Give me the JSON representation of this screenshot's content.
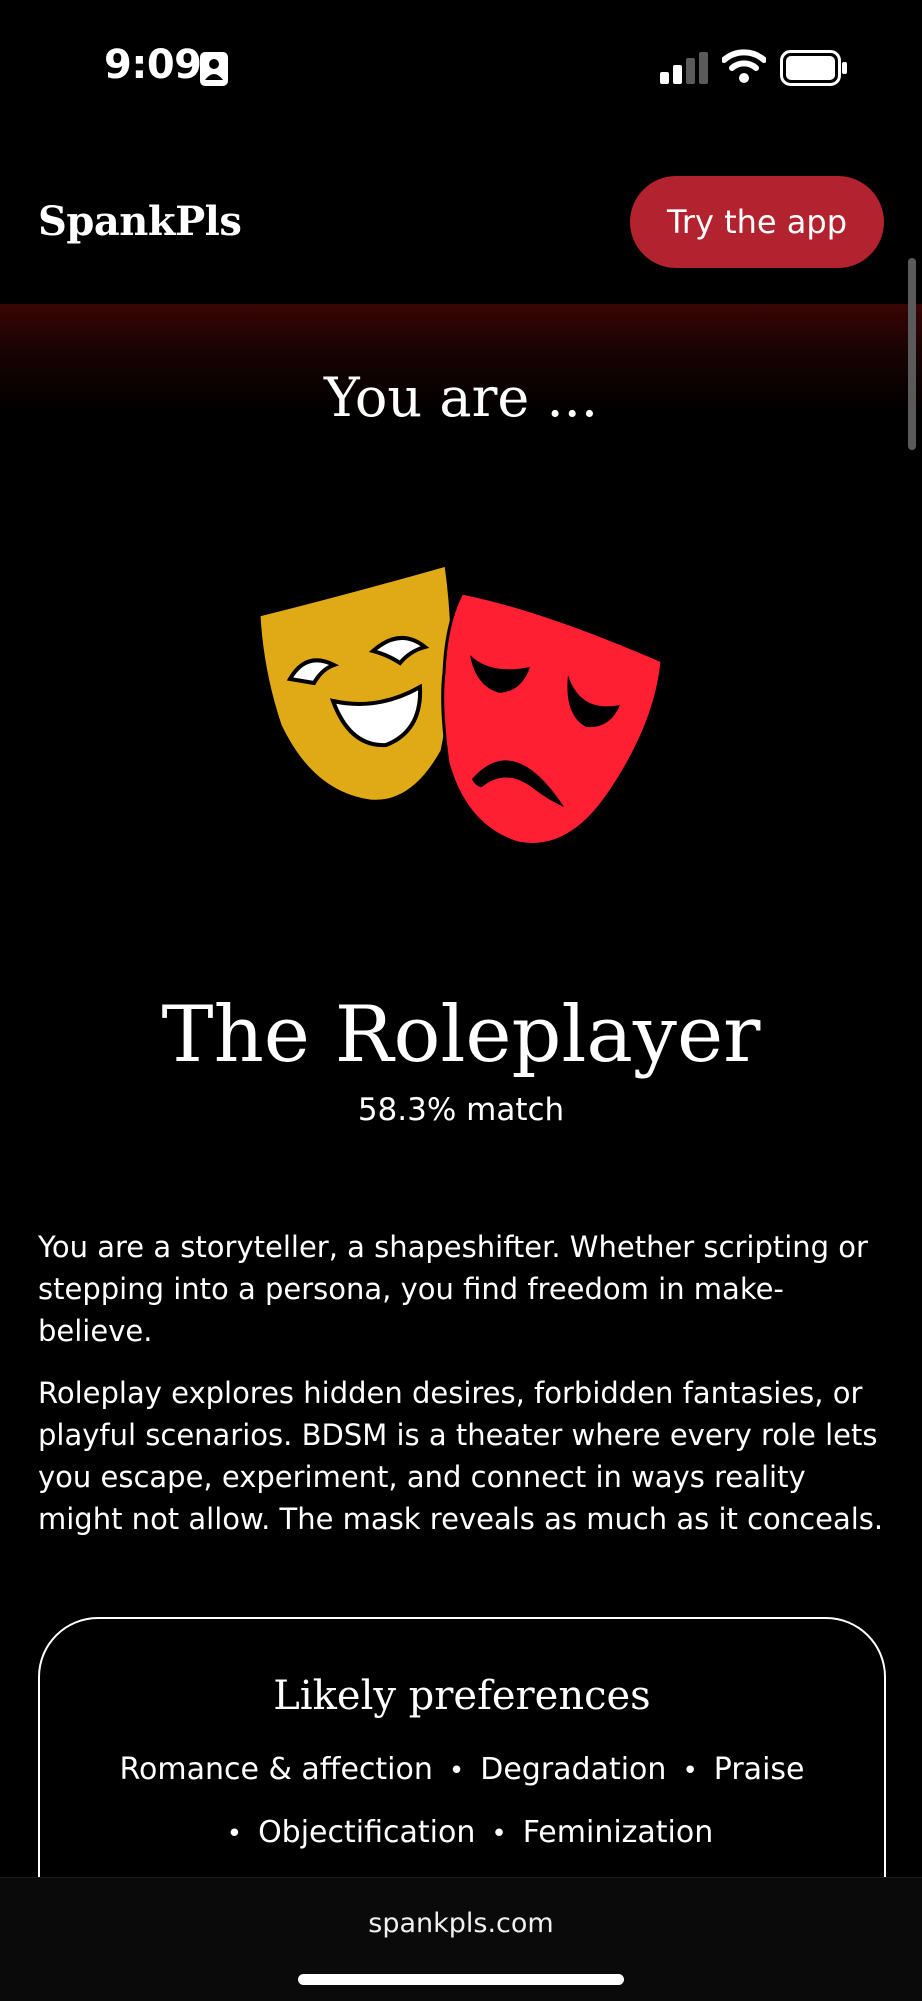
{
  "status_bar": {
    "time": "9:09"
  },
  "header": {
    "logo": "SpankPls",
    "cta_label": "Try the app"
  },
  "result": {
    "intro": "You are ...",
    "title": "The Roleplayer",
    "match": "58.3% match",
    "description": [
      "You are a storyteller, a shapeshifter. Whether scripting or stepping into a persona, you find freedom in make-believe.",
      "Roleplay explores hidden desires, forbidden fantasies, or playful scenarios. BDSM is a theater where every role lets you escape, experiment, and connect in ways reality might not allow. The mask reveals as much as it conceals."
    ],
    "illustration": "theater-masks-icon"
  },
  "preferences": {
    "title": "Likely preferences",
    "items": [
      "Romance & affection",
      "Degradation",
      "Praise",
      "Objectification",
      "Feminization"
    ]
  },
  "browser": {
    "url": "spankpls.com"
  },
  "colors": {
    "accent": "#b3222f",
    "comedy_mask": "#e0aa16",
    "tragedy_mask": "#ff1f33"
  }
}
